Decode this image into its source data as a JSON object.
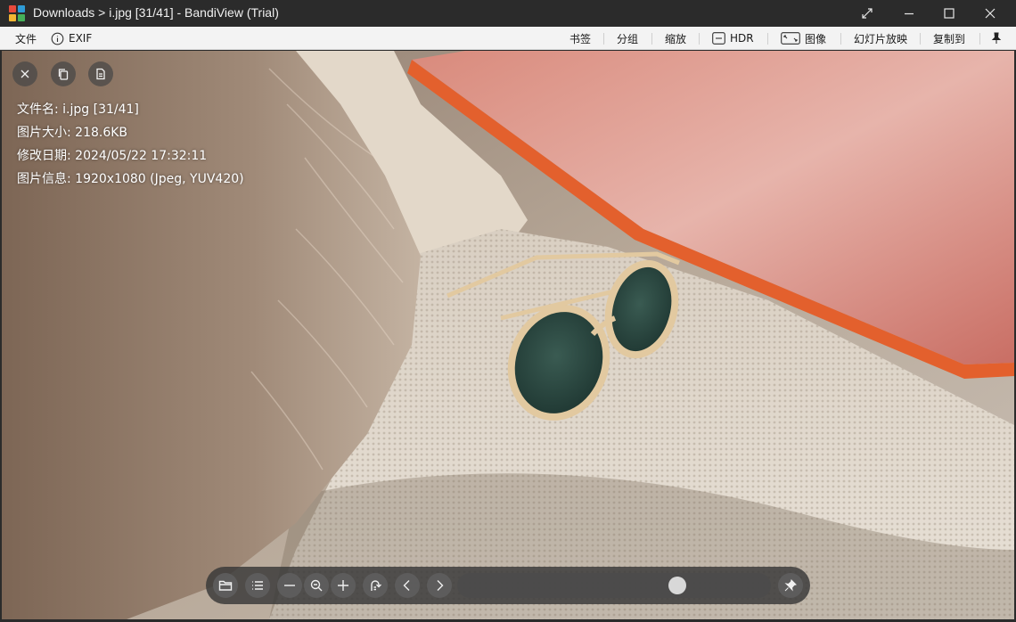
{
  "titlebar": {
    "title": "Downloads > i.jpg [31/41] - BandiView (Trial)"
  },
  "menu": {
    "file": "文件",
    "exif": "EXIF",
    "bookmark": "书签",
    "group": "分组",
    "zoom": "缩放",
    "hdr": "HDR",
    "image": "图像",
    "slideshow": "幻灯片放映",
    "copy_to": "复制到"
  },
  "info": {
    "filename": "文件名: i.jpg [31/41]",
    "size": "图片大小: 218.6KB",
    "modified": "修改日期: 2024/05/22 17:32:11",
    "image_info": "图片信息: 1920x1080 (Jpeg, YUV420)"
  },
  "slider": {
    "position_fraction": 0.72
  },
  "icons": {
    "logo_colors": [
      "#e64a3b",
      "#2e9bd6",
      "#f2b632",
      "#45b05a"
    ],
    "overlay": [
      "close-icon",
      "copy-icon",
      "document-icon"
    ],
    "bottom": [
      "folder-icon",
      "list-icon",
      "minus-icon",
      "zoom-out-icon",
      "plus-icon",
      "rotate-icon",
      "chevron-left-icon",
      "chevron-right-icon",
      "pin-icon"
    ]
  }
}
